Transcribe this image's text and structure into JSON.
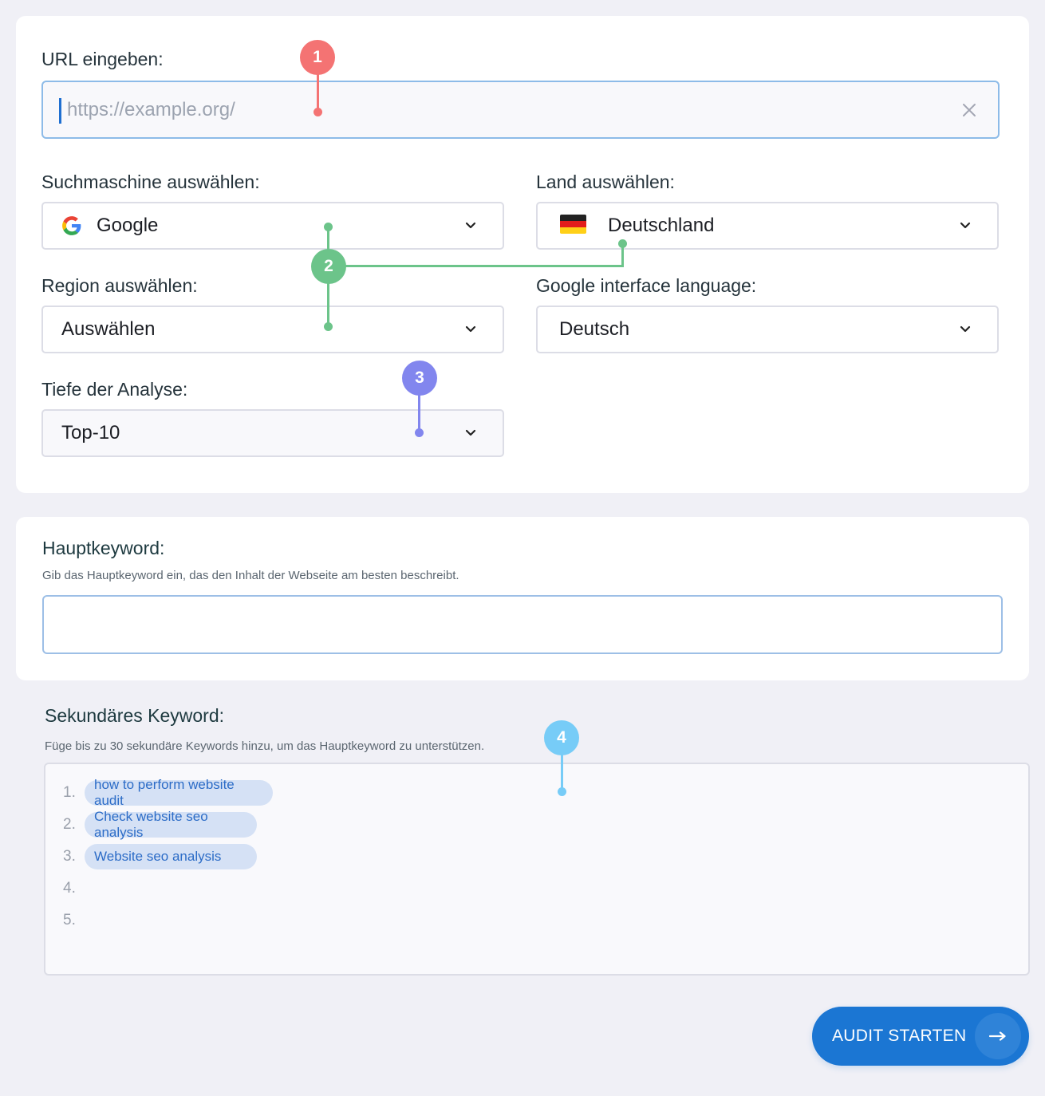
{
  "url_section": {
    "label": "URL eingeben:",
    "input_value": "",
    "input_placeholder": "https://example.org/",
    "clear_icon": "close-icon"
  },
  "search_engine": {
    "label": "Suchmaschine auswählen:",
    "selected": "Google",
    "icon": "google-logo-icon"
  },
  "country": {
    "label": "Land auswählen:",
    "selected": "Deutschland",
    "icon": "germany-flag-icon"
  },
  "region": {
    "label": "Region auswählen:",
    "selected": "Auswählen"
  },
  "interface_language": {
    "label": "Google interface language:",
    "selected": "Deutsch"
  },
  "depth": {
    "label": "Tiefe der Analyse:",
    "selected": "Top-10"
  },
  "main_keyword": {
    "label": "Hauptkeyword:",
    "hint": "Gib das Hauptkeyword ein, das den Inhalt der Webseite am besten beschreibt.",
    "value": ""
  },
  "secondary_keywords": {
    "label": "Sekundäres Keyword:",
    "hint": "Füge bis zu 30 sekundäre Keywords hinzu, um das Hauptkeyword zu unterstützen.",
    "rows": [
      {
        "number": "1.",
        "keyword": "how to perform website audit"
      },
      {
        "number": "2.",
        "keyword": "Check website seo analysis"
      },
      {
        "number": "3.",
        "keyword": "Website seo analysis"
      },
      {
        "number": "4.",
        "keyword": ""
      },
      {
        "number": "5.",
        "keyword": ""
      }
    ]
  },
  "start_button": {
    "label": "AUDIT STARTEN",
    "icon": "arrow-right-icon"
  },
  "annotations": [
    {
      "number": "1",
      "color": "#f47373"
    },
    {
      "number": "2",
      "color": "#6cc48a"
    },
    {
      "number": "3",
      "color": "#8286ee"
    },
    {
      "number": "4",
      "color": "#77ccf7"
    }
  ],
  "colors": {
    "accent": "#1b76d3",
    "chip_bg": "#d5e1f5",
    "chip_text": "#2c6cc7",
    "page_bg": "#f0f0f6"
  }
}
